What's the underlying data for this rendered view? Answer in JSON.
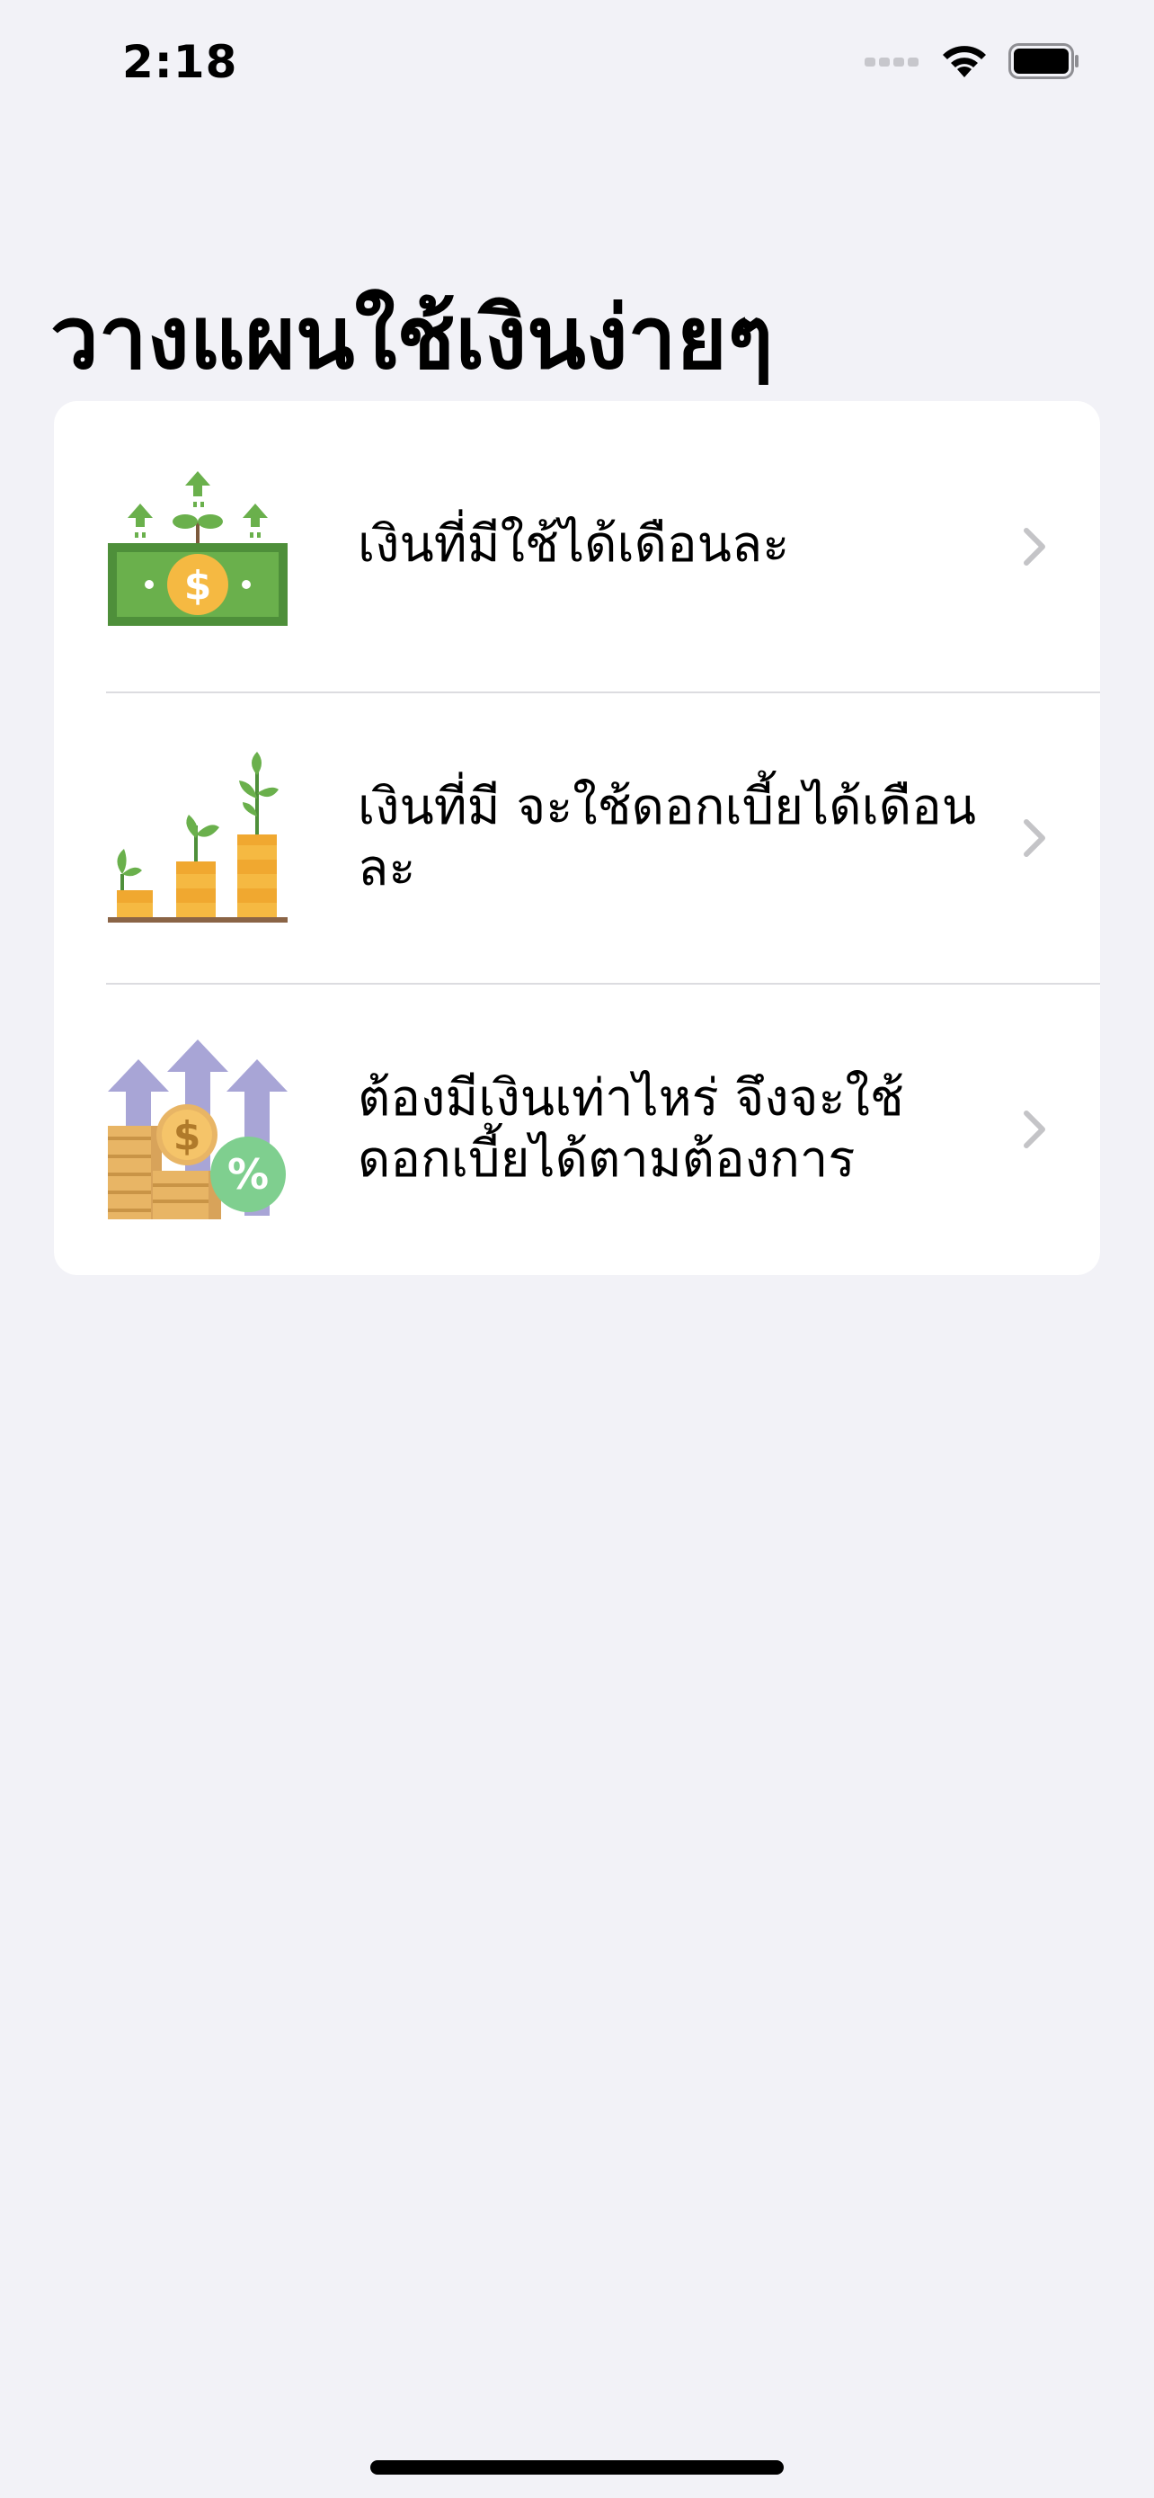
{
  "status_bar": {
    "time": "2:18",
    "icons": [
      "cellular-signal-icon",
      "wifi-icon",
      "battery-icon"
    ]
  },
  "page": {
    "title": "วางแผนใช้เงินง่ายๆ"
  },
  "menu": {
    "items": [
      {
        "label": "เงินที่มีใช้ได้เดือนละ",
        "icon": "money-growth-icon"
      },
      {
        "label": "เงินที่มี จะใช้ดอกเบี้ยได้เดือนละ",
        "icon": "coin-plants-icon"
      },
      {
        "label": "ต้องมีเงินเท่าไหร่ จึงจะใช้ดอกเบี้ยได้ตามต้องการ",
        "icon": "interest-arrows-icon"
      }
    ]
  },
  "colors": {
    "background": "#f2f2f7",
    "card": "#ffffff",
    "chevron": "#c4c4c7",
    "green": "#6ab04c",
    "gold": "#f5b942",
    "lavender": "#a8a5d6"
  }
}
